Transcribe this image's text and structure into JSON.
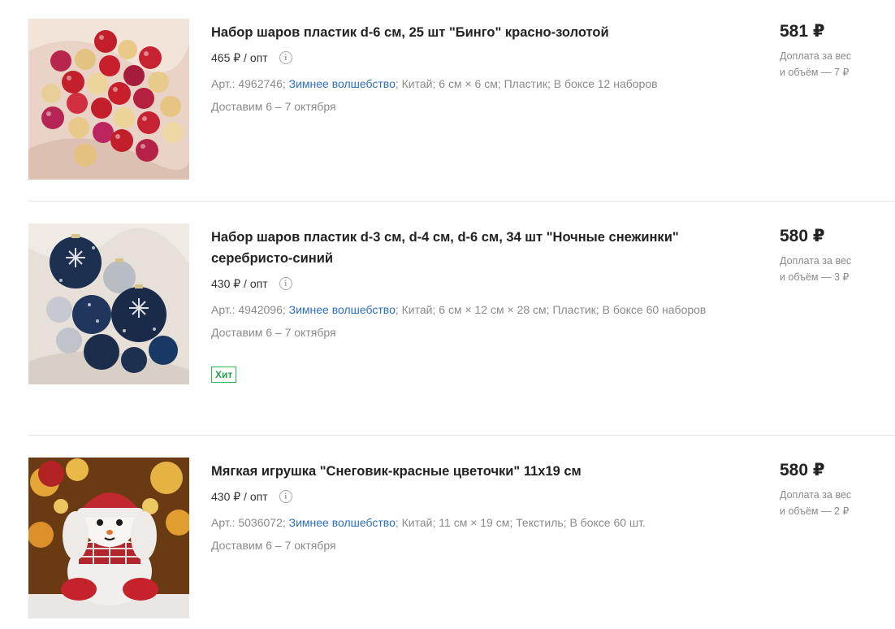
{
  "products": [
    {
      "title": "Набор шаров пластик d-6 см, 25 шт \"Бинго\" красно-золотой",
      "opt_price": "465 ₽ / опт",
      "art_label": "Арт.: 4962746;",
      "brand": "Зимнее волшебство",
      "meta_rest": "; Китай; 6 см × 6 см; Пластик; В боксе 12 наборов",
      "delivery": "Доставим 6 – 7 октября",
      "price": "581 ₽",
      "surcharge": "Доплата за вес\nи объём — 7 ₽",
      "image": "red-gold-ornaments-image"
    },
    {
      "title": "Набор шаров пластик d-3 см, d-4 см, d-6 см, 34 шт \"Ночные снежинки\" серебристо-синий",
      "opt_price": "430 ₽ / опт",
      "art_label": "Арт.: 4942096;",
      "brand": "Зимнее волшебство",
      "meta_rest": "; Китай; 6 см × 12 см × 28 см; Пластик; В боксе 60 наборов",
      "delivery": "Доставим 6 – 7 октября",
      "badge": "Хит",
      "price": "580 ₽",
      "surcharge": "Доплата за вес\nи объём — 3 ₽",
      "image": "blue-silver-ornaments-image"
    },
    {
      "title": "Мягкая игрушка \"Снеговик-красные цветочки\" 11х19 см",
      "opt_price": "430 ₽ / опт",
      "art_label": "Арт.: 5036072;",
      "brand": "Зимнее волшебство",
      "meta_rest": "; Китай; 11 см × 19 см; Текстиль; В боксе 60 шт.",
      "delivery": "Доставим 6 – 7 октября",
      "price": "580 ₽",
      "surcharge": "Доплата за вес\nи объём — 2 ₽",
      "image": "snowman-toy-image"
    }
  ],
  "icons": {
    "info": "info-icon"
  },
  "colors": {
    "link": "#2d6fbd",
    "badge": "#2eb55a",
    "muted": "#8a8a8a"
  }
}
